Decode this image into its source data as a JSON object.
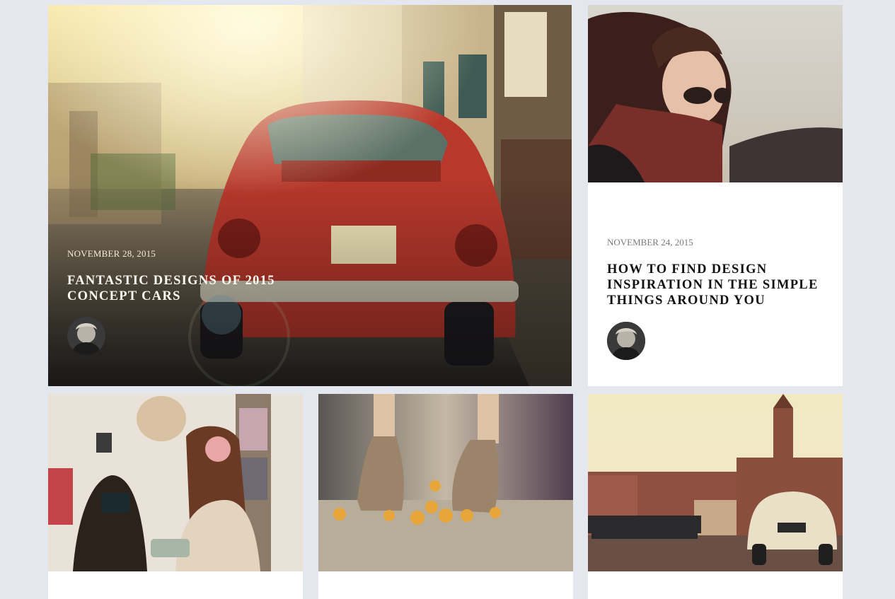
{
  "posts": [
    {
      "date": "NOVEMBER 28, 2015",
      "title": "FANTASTIC DESIGNS OF 2015 CONCEPT CARS"
    },
    {
      "date": "NOVEMBER 24, 2015",
      "title": "HOW TO FIND DESIGN INSPIRATION IN THE SIMPLE THINGS AROUND YOU"
    }
  ],
  "colors": {
    "page_background": "#e4e8ee",
    "card_background": "#ffffff",
    "featured_text": "#fffaf0",
    "title_text": "#111111",
    "date_text": "#7b7b7b"
  },
  "icons": [
    "author-avatar"
  ]
}
